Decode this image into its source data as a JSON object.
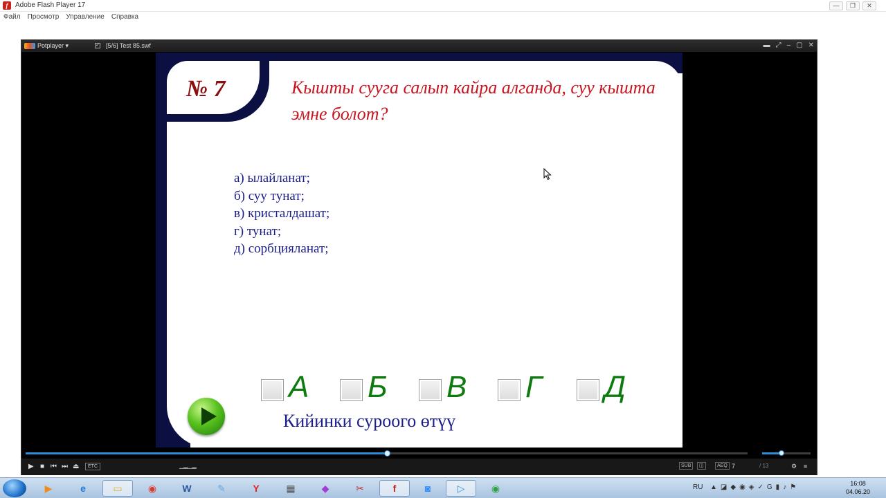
{
  "flash_window": {
    "title": "Adobe Flash Player 17",
    "menu": [
      "Файл",
      "Просмотр",
      "Управление",
      "Справка"
    ],
    "buttons": {
      "minimize": "—",
      "restore": "❐",
      "close": "✕"
    }
  },
  "potplayer": {
    "app_menu": "Potplayer ▾",
    "file_title": "[5/6] Test 85.swf",
    "controls": {
      "etc_label": "ETC",
      "sub_label": "SUB",
      "aeq_label": "AEQ",
      "current_page": "7",
      "total_pages": "/ 13",
      "seek_progress": 0.5,
      "volume_level": 0.4
    }
  },
  "slide": {
    "question_number": "№ 7",
    "question_text": "Кышты сууга салып кайра алганда, суу кышта эмне болот?",
    "answers": [
      "а) ылайланат;",
      "б) суу тунат;",
      "в) кристалдашат;",
      "г) тунат;",
      "д) сорбцияланат;"
    ],
    "options": [
      "А",
      "Б",
      "В",
      "Г",
      "Д"
    ],
    "next_label": "Кийинки суроого өтүү",
    "colors": {
      "navy": "#0b0f42",
      "question": "#c8141e",
      "answers": "#1a1d8a",
      "options": "#0f7a0f"
    }
  },
  "taskbar": {
    "language": "RU",
    "time": "16:08",
    "date": "04.06.20",
    "apps": [
      "start-orb-icon",
      "media-player-icon",
      "internet-explorer-icon",
      "folder-icon",
      "chrome-icon",
      "word-icon",
      "paint-icon",
      "yandex-icon",
      "calculator-icon",
      "gem-icon",
      "scissors-icon",
      "flash-player-icon",
      "zoom-icon",
      "play-icon",
      "chrome-badge-icon"
    ]
  }
}
